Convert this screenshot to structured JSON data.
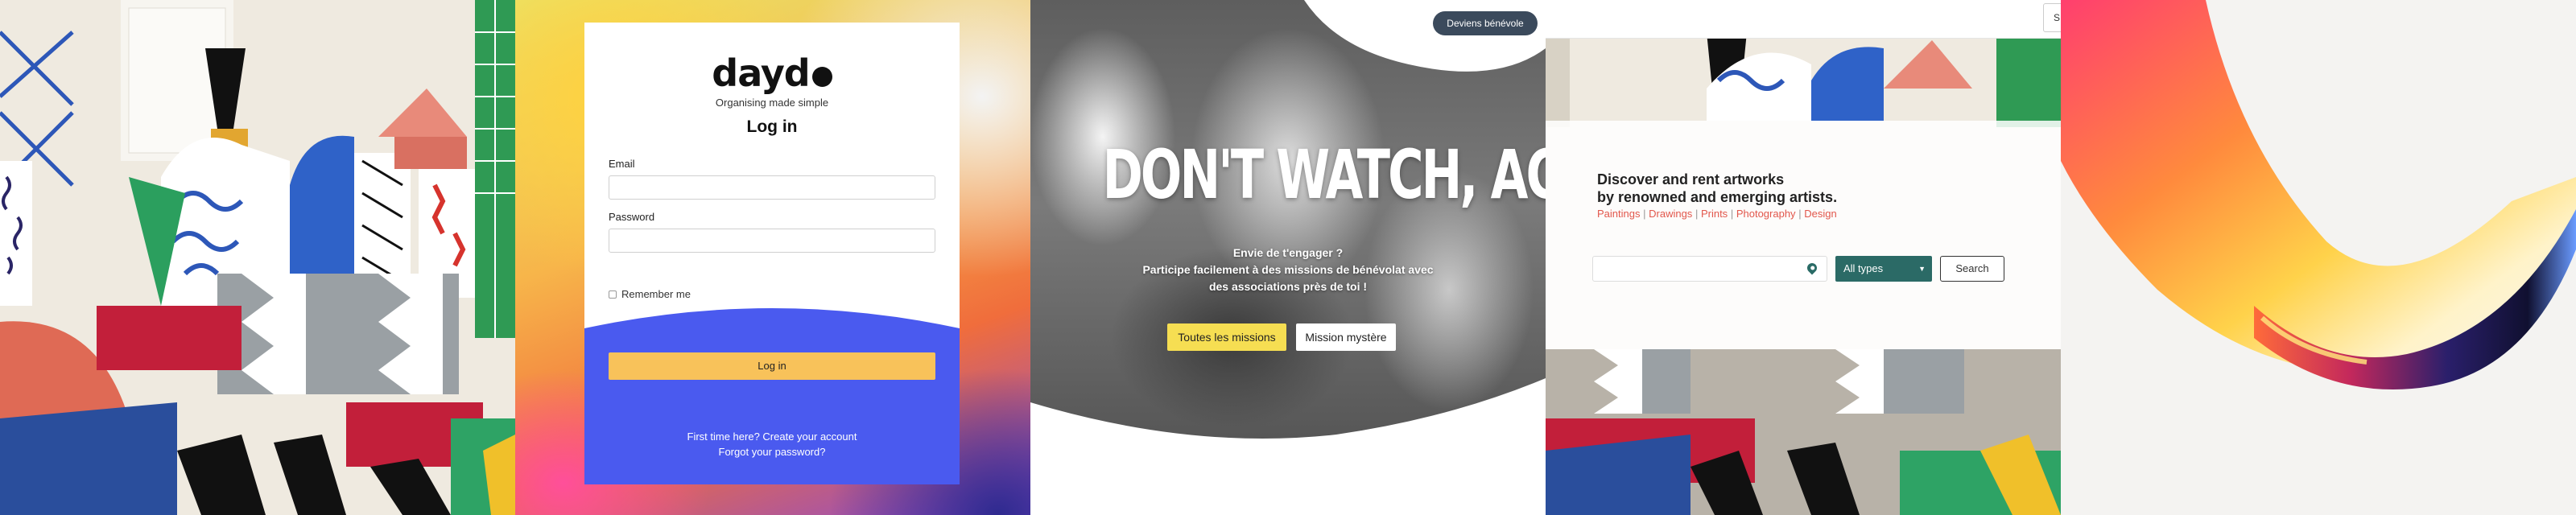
{
  "panel_login": {
    "logo_text": "dayd",
    "tagline": "Organising made simple",
    "title": "Log in",
    "email_label": "Email",
    "password_label": "Password",
    "remember_label": "Remember me",
    "login_button": "Log in",
    "create_account_link": "First time here? Create your account",
    "forgot_password_link": "Forgot your password?",
    "colors": {
      "accent_blue": "#4a5aef",
      "button_yellow": "#f8c25a"
    }
  },
  "panel_volunteer": {
    "top_button": "Deviens bénévole",
    "hero_title": "DON'T WATCH, ACT!",
    "subtitle_lines": [
      "Envie de t'engager ?",
      "Participe facilement à des missions de bénévolat avec",
      "des associations près de toi !"
    ],
    "primary_button": "Toutes les missions",
    "secondary_button": "Mission mystère",
    "colors": {
      "yellow": "#f6de52",
      "pill": "#3b4a5c"
    }
  },
  "panel_artworks": {
    "top_button": "S",
    "title_lines": [
      "Discover and rent artworks",
      "by renowned and emerging artists."
    ],
    "categories": [
      "Paintings",
      "Drawings",
      "Prints",
      "Photography",
      "Design"
    ],
    "category_separator": "|",
    "location_icon": "location-pin-icon",
    "select_value": "All types",
    "search_button": "Search",
    "colors": {
      "teal": "#2b6a66",
      "category_red": "#e2574c"
    }
  }
}
